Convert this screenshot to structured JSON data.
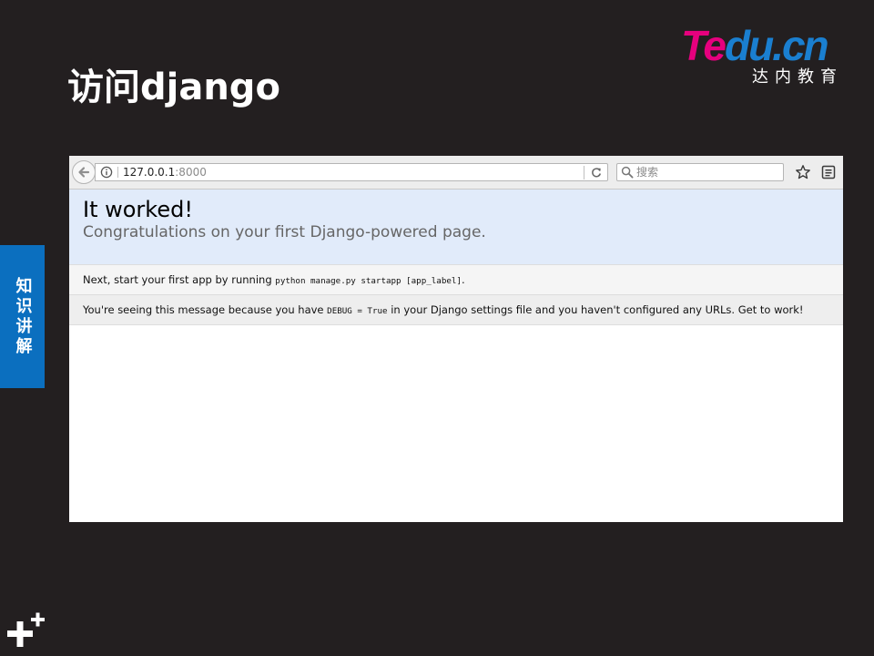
{
  "slide": {
    "title": "访问django",
    "side_tab": "知识讲解"
  },
  "logo": {
    "brand_part1": "Te",
    "brand_part2": "du.cn",
    "subtitle": "达内教育"
  },
  "browser": {
    "url_host": "127.0.0.1",
    "url_port": ":8000",
    "search_placeholder": "搜索",
    "icons": [
      "back-arrow-icon",
      "info-icon",
      "reload-icon",
      "search-icon",
      "star-icon",
      "reader-view-icon"
    ]
  },
  "page": {
    "heading": "It worked!",
    "subheading": "Congratulations on your first Django-powered page.",
    "instructions_prefix": "Next, start your first app by running ",
    "instructions_code": "python manage.py startapp [app_label]",
    "instructions_suffix": ".",
    "explanation_prefix": "You're seeing this message because you have ",
    "explanation_code": "DEBUG = True",
    "explanation_suffix": " in your Django settings file and you haven't configured any URLs. Get to work!"
  },
  "colors": {
    "slide_background": "#231f20",
    "side_tab": "#0b6fbf",
    "logo_magenta": "#e6007e",
    "logo_blue": "#1a7fd0",
    "summary_background": "#e1ebfa"
  }
}
